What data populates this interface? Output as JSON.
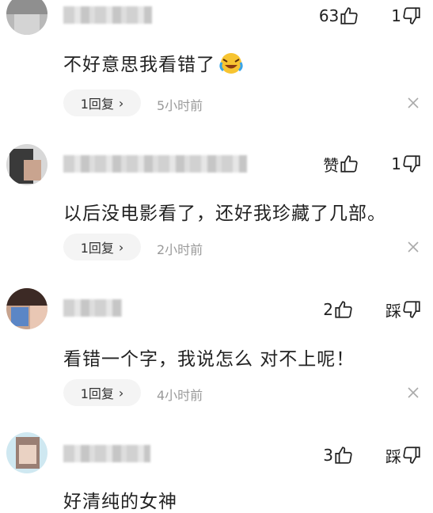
{
  "comments": [
    {
      "like_label": "63",
      "dislike_label": "1",
      "text": "不好意思我看错了",
      "emoji": "crying-laughing-emoji",
      "reply_label": "1回复",
      "time": "5小时前"
    },
    {
      "like_label": "赞",
      "dislike_label": "1",
      "text": "以后没电影看了，还好我珍藏了几部。",
      "reply_label": "1回复",
      "time": "2小时前"
    },
    {
      "like_label": "2",
      "dislike_label": "踩",
      "text": "看错一个字，我说怎么 对不上呢！",
      "reply_label": "1回复",
      "time": "4小时前"
    },
    {
      "like_label": "3",
      "dislike_label": "踩",
      "text": "好清纯的女神"
    }
  ],
  "colors": {
    "text": "#222222",
    "muted": "#9a9a9a",
    "pill_bg": "#f4f4f4",
    "background": "#ffffff"
  }
}
